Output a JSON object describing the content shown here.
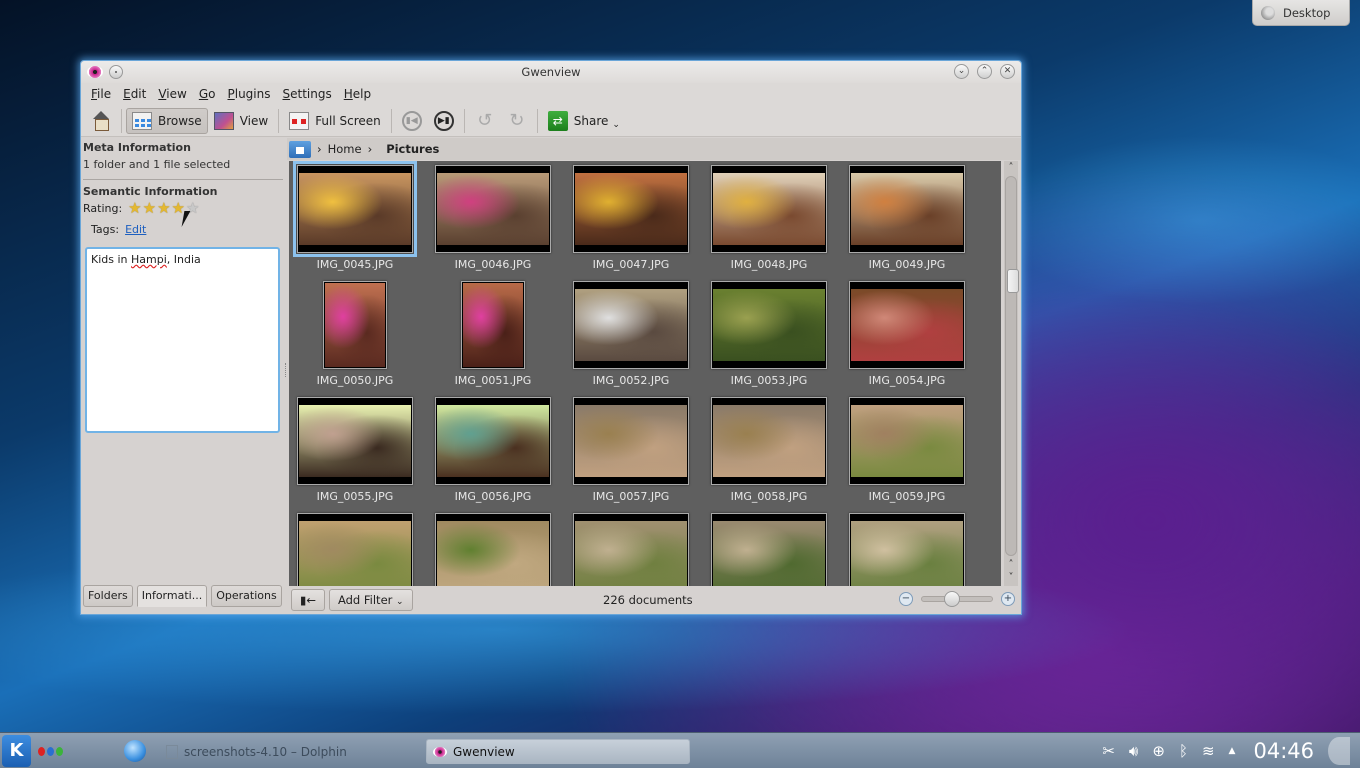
{
  "desktop": {
    "button_label": "Desktop"
  },
  "window": {
    "title": "Gwenview",
    "controls": [
      "minimize",
      "maximize",
      "close"
    ]
  },
  "menubar": [
    {
      "label": "File",
      "mnemonic": "F",
      "rest": "ile"
    },
    {
      "label": "Edit",
      "mnemonic": "E",
      "rest": "dit"
    },
    {
      "label": "View",
      "mnemonic": "V",
      "rest": "iew"
    },
    {
      "label": "Go",
      "mnemonic": "G",
      "rest": "o"
    },
    {
      "label": "Plugins",
      "mnemonic": "P",
      "rest": "lugins"
    },
    {
      "label": "Settings",
      "mnemonic": "S",
      "rest": "ettings"
    },
    {
      "label": "Help",
      "mnemonic": "H",
      "rest": "elp"
    }
  ],
  "toolbar": {
    "home_icon": "home-icon",
    "browse_label": "Browse",
    "view_label": "View",
    "fullscreen_label": "Full Screen",
    "previous_icon": "previous-icon",
    "next_icon": "next-icon",
    "rotate_left_icon": "rotate-left-icon",
    "rotate_right_icon": "rotate-right-icon",
    "share_label": "Share"
  },
  "sidebar": {
    "meta_heading": "Meta Information",
    "selection_text": "1 folder and 1 file selected",
    "semantic_heading": "Semantic Information",
    "rating_label": "Rating:",
    "rating_value": 4,
    "rating_max": 5,
    "tags_label": "Tags:",
    "tags_edit_link": "Edit",
    "comment_pre": "Kids in ",
    "comment_misspelled": "Hampi",
    "comment_post": ", India",
    "tabs": [
      {
        "label": "Folders",
        "active": false
      },
      {
        "label": "Informati...",
        "active": true
      },
      {
        "label": "Operations",
        "active": false
      }
    ]
  },
  "breadcrumb": {
    "items": [
      "Home"
    ],
    "current": "Pictures"
  },
  "thumbnails": [
    {
      "name": "IMG_0045.JPG",
      "selected": true,
      "portrait": false,
      "colors": [
        "#c89560",
        "#5a3a28",
        "#f0c040"
      ]
    },
    {
      "name": "IMG_0046.JPG",
      "selected": false,
      "portrait": false,
      "colors": [
        "#b89a78",
        "#5a4030",
        "#d04080"
      ]
    },
    {
      "name": "IMG_0047.JPG",
      "selected": false,
      "portrait": false,
      "colors": [
        "#c07040",
        "#4a2a1a",
        "#e0b030"
      ]
    },
    {
      "name": "IMG_0048.JPG",
      "selected": false,
      "portrait": false,
      "colors": [
        "#e0d0b8",
        "#7a4a30",
        "#e0b040"
      ]
    },
    {
      "name": "IMG_0049.JPG",
      "selected": false,
      "portrait": false,
      "colors": [
        "#d8c8a8",
        "#6a4028",
        "#d08040"
      ]
    },
    {
      "name": "IMG_0050.JPG",
      "selected": false,
      "portrait": true,
      "colors": [
        "#c07050",
        "#5a2a20",
        "#e040a0"
      ]
    },
    {
      "name": "IMG_0051.JPG",
      "selected": false,
      "portrait": true,
      "colors": [
        "#b86a48",
        "#4a2018",
        "#e040a0"
      ]
    },
    {
      "name": "IMG_0052.JPG",
      "selected": false,
      "portrait": false,
      "colors": [
        "#b0a080",
        "#5a4a40",
        "#e0e0e0"
      ]
    },
    {
      "name": "IMG_0053.JPG",
      "selected": false,
      "portrait": false,
      "colors": [
        "#6a8030",
        "#3a5020",
        "#9aa050"
      ]
    },
    {
      "name": "IMG_0054.JPG",
      "selected": false,
      "portrait": false,
      "colors": [
        "#7a4a28",
        "#b04040",
        "#d08878"
      ]
    },
    {
      "name": "IMG_0055.JPG",
      "selected": false,
      "portrait": false,
      "colors": [
        "#e8f0b0",
        "#3a2a20",
        "#c0a090"
      ]
    },
    {
      "name": "IMG_0056.JPG",
      "selected": false,
      "portrait": false,
      "colors": [
        "#d0e8a0",
        "#4a3020",
        "#60a090"
      ]
    },
    {
      "name": "IMG_0057.JPG",
      "selected": false,
      "portrait": false,
      "colors": [
        "#8a7a68",
        "#c0a080",
        "#9a8050"
      ]
    },
    {
      "name": "IMG_0058.JPG",
      "selected": false,
      "portrait": false,
      "colors": [
        "#8a7a68",
        "#c0a080",
        "#9a8050"
      ]
    },
    {
      "name": "IMG_0059.JPG",
      "selected": false,
      "portrait": false,
      "colors": [
        "#c0a080",
        "#7a8a40",
        "#a08060"
      ]
    },
    {
      "name": "",
      "selected": false,
      "portrait": false,
      "colors": [
        "#c0a070",
        "#7a8a40",
        "#a08a60"
      ]
    },
    {
      "name": "",
      "selected": false,
      "portrait": false,
      "colors": [
        "#a08a60",
        "#c0a880",
        "#608030"
      ]
    },
    {
      "name": "",
      "selected": false,
      "portrait": false,
      "colors": [
        "#a09070",
        "#708040",
        "#c0b090"
      ]
    },
    {
      "name": "",
      "selected": false,
      "portrait": false,
      "colors": [
        "#9a8a70",
        "#506a30",
        "#c0b090"
      ]
    },
    {
      "name": "",
      "selected": false,
      "portrait": false,
      "colors": [
        "#b0a080",
        "#6a8040",
        "#d0c0a0"
      ]
    }
  ],
  "statusbar": {
    "toggle_sidebar_label": "▮←",
    "add_filter_label": "Add Filter",
    "document_count": "226 documents",
    "zoom_fraction": 0.4
  },
  "taskbar": {
    "kmenu_label": "K",
    "tasks": [
      {
        "label": "screenshots-4.10 – Dolphin",
        "active": false
      },
      {
        "label": "Gwenview",
        "active": true
      }
    ],
    "tray_icons": [
      "scissors-icon",
      "volume-icon",
      "network-icon",
      "bluetooth-icon",
      "wifi-icon",
      "expand-arrow-icon"
    ],
    "clock": "04:46"
  }
}
